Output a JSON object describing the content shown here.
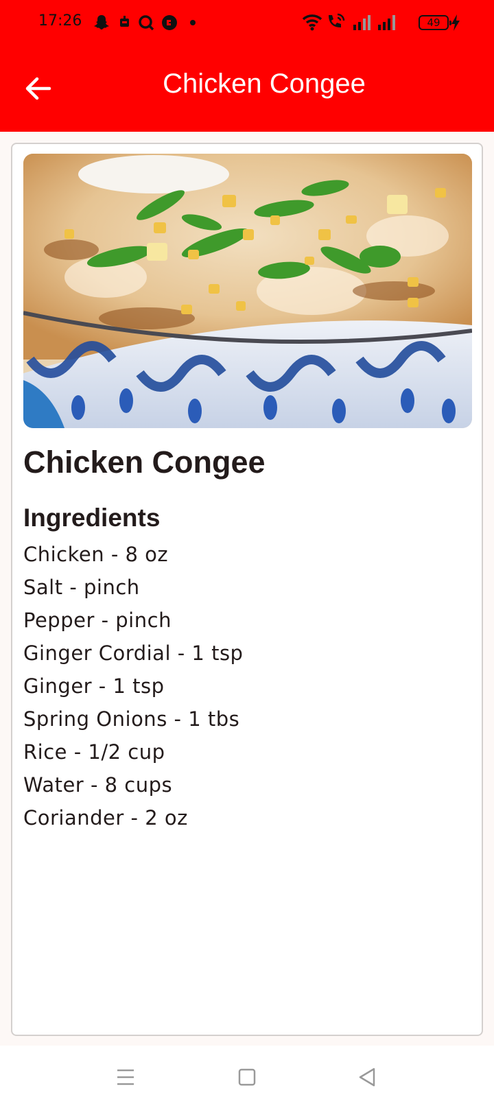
{
  "status_bar": {
    "time": "17:26",
    "battery": "49",
    "icons": [
      "snapchat-icon",
      "notification-icon",
      "search-app-icon",
      "app-icon",
      "dot-icon",
      "wifi-icon",
      "wifi-call-icon",
      "signal-icon",
      "signal-icon",
      "charging-icon"
    ]
  },
  "app_bar": {
    "title": "Chicken Congee",
    "back_icon": "arrow-back-icon",
    "background": "#ff0000"
  },
  "recipe": {
    "name": "Chicken Congee",
    "ingredients_heading": "Ingredients",
    "ingredients": [
      "Chicken - 8 oz",
      "Salt - pinch",
      "Pepper - pinch",
      "Ginger Cordial - 1 tsp",
      "Ginger - 1 tsp",
      "Spring Onions - 1 tbs",
      "Rice - 1/2 cup",
      "Water - 8 cups",
      "Coriander - 2 oz"
    ]
  },
  "nav_bar": {
    "icons": [
      "menu-icon",
      "home-icon",
      "back-icon"
    ]
  }
}
